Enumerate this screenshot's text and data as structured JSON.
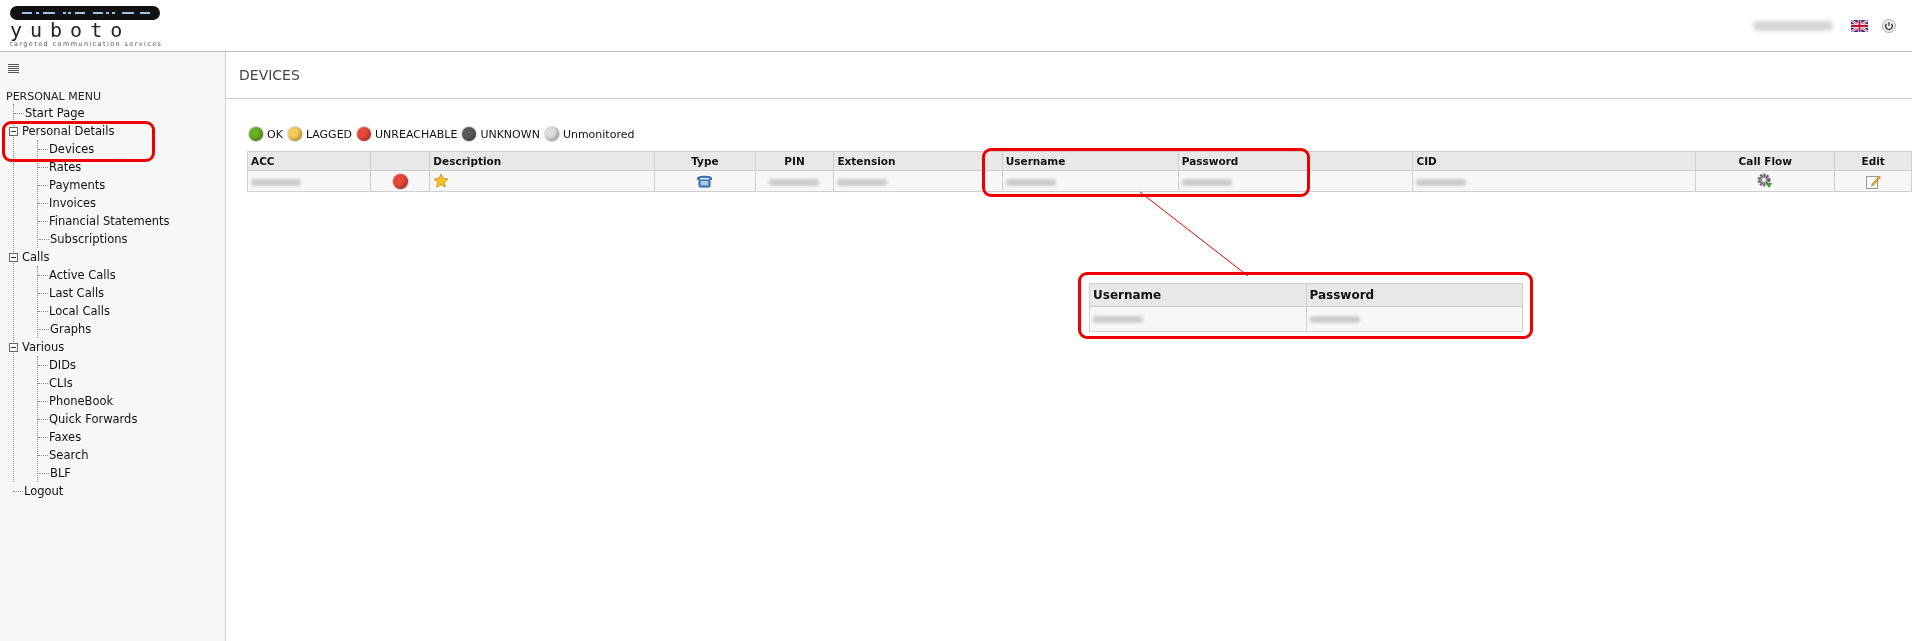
{
  "header": {
    "logo": "yuboto",
    "tagline": "targeted communication services"
  },
  "sidebar": {
    "title": "PERSONAL MENU",
    "items": [
      {
        "label": "Start Page"
      },
      {
        "label": "Personal Details",
        "expanded": true,
        "children": [
          {
            "label": "Devices"
          },
          {
            "label": "Rates"
          },
          {
            "label": "Payments"
          },
          {
            "label": "Invoices"
          },
          {
            "label": "Financial Statements"
          },
          {
            "label": "Subscriptions"
          }
        ]
      },
      {
        "label": "Calls",
        "expanded": true,
        "children": [
          {
            "label": "Active Calls"
          },
          {
            "label": "Last Calls"
          },
          {
            "label": "Local Calls"
          },
          {
            "label": "Graphs"
          }
        ]
      },
      {
        "label": "Various",
        "expanded": true,
        "children": [
          {
            "label": "DIDs"
          },
          {
            "label": "CLIs"
          },
          {
            "label": "PhoneBook"
          },
          {
            "label": "Quick Forwards"
          },
          {
            "label": "Faxes"
          },
          {
            "label": "Search"
          },
          {
            "label": "BLF"
          }
        ]
      },
      {
        "label": "Logout"
      }
    ]
  },
  "page": {
    "title": "DEVICES"
  },
  "legend": [
    {
      "label": "OK",
      "color": "#6ab023"
    },
    {
      "label": "LAGGED",
      "color": "#f7c95a"
    },
    {
      "label": "UNREACHABLE",
      "color": "#e8473a"
    },
    {
      "label": "UNKNOWN",
      "color": "#5a5a5a"
    },
    {
      "label": "Unmonitored",
      "color": "#dcdcdc"
    }
  ],
  "table": {
    "columns": [
      {
        "label": "ACC"
      },
      {},
      {
        "label": "Description"
      },
      {
        "label": "Type"
      },
      {
        "label": "PIN"
      },
      {
        "label": "Extension"
      },
      {
        "label": "Username"
      },
      {
        "label": "Password"
      },
      {
        "label": "CID"
      },
      {
        "label": "Call Flow"
      },
      {
        "label": "Edit"
      }
    ],
    "rows": [
      {
        "cells": [
          {
            "kind": "blurred"
          },
          {
            "kind": "status",
            "color": "#e8473a"
          },
          {
            "kind": "star"
          },
          {
            "kind": "phone"
          },
          {
            "kind": "blurred"
          },
          {
            "kind": "blurred"
          },
          {
            "kind": "blurred"
          },
          {
            "kind": "blurred"
          },
          {
            "kind": "blurred"
          },
          {
            "kind": "gear"
          },
          {
            "kind": "edit"
          }
        ]
      }
    ]
  },
  "callout": {
    "columns": [
      "Username",
      "Password"
    ]
  }
}
